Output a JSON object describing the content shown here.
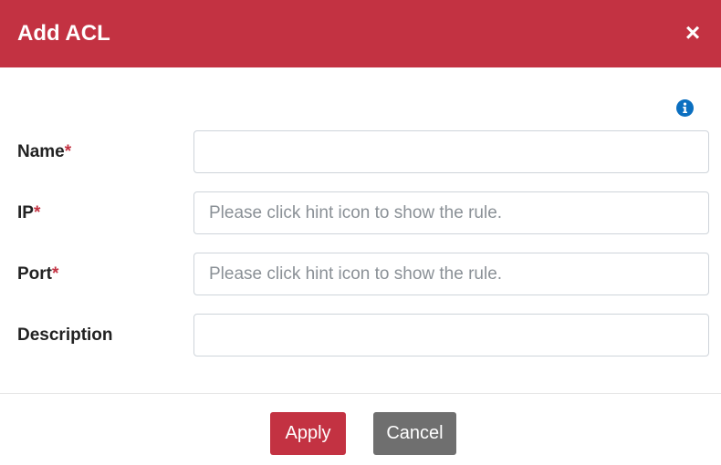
{
  "dialog": {
    "title": "Add ACL",
    "close_symbol": "×",
    "info_icon": "info-circle-icon"
  },
  "form": {
    "name": {
      "label": "Name",
      "required_mark": "*",
      "value": "",
      "placeholder": ""
    },
    "ip": {
      "label": "IP",
      "required_mark": "*",
      "value": "",
      "placeholder": "Please click hint icon to show the rule."
    },
    "port": {
      "label": "Port",
      "required_mark": "*",
      "value": "",
      "placeholder": "Please click hint icon to show the rule."
    },
    "description": {
      "label": "Description",
      "value": "",
      "placeholder": ""
    }
  },
  "footer": {
    "apply_label": "Apply",
    "cancel_label": "Cancel"
  },
  "colors": {
    "accent": "#c33242",
    "cancel": "#6f6f6f",
    "info": "#0b6fc0"
  }
}
